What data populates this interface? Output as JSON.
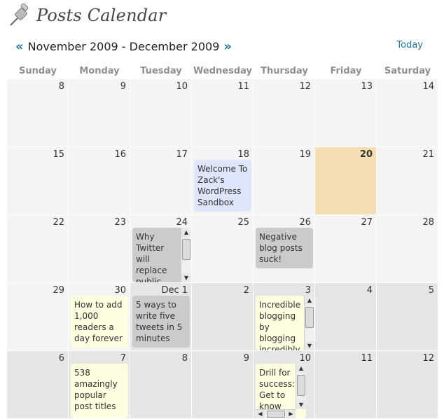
{
  "header": {
    "title": "Posts Calendar",
    "icon": "pushpin-icon"
  },
  "nav": {
    "prev": "«",
    "next": "»",
    "range": "November 2009 - December 2009",
    "today": "Today"
  },
  "weekdays": [
    "Sunday",
    "Monday",
    "Tuesday",
    "Wednesday",
    "Thursday",
    "Friday",
    "Saturday"
  ],
  "weeks": [
    {
      "days": [
        {
          "n": "8"
        },
        {
          "n": "9"
        },
        {
          "n": "10"
        },
        {
          "n": "11"
        },
        {
          "n": "12"
        },
        {
          "n": "13"
        },
        {
          "n": "14"
        }
      ]
    },
    {
      "days": [
        {
          "n": "15"
        },
        {
          "n": "16"
        },
        {
          "n": "17"
        },
        {
          "n": "18",
          "post": {
            "text": "Welcome To Zack's WordPress Sandbox",
            "color": "blue"
          }
        },
        {
          "n": "19"
        },
        {
          "n": "20",
          "today": true
        },
        {
          "n": "21"
        }
      ]
    },
    {
      "days": [
        {
          "n": "22"
        },
        {
          "n": "23"
        },
        {
          "n": "24",
          "post": {
            "text": "Why Twitter will replace public",
            "color": "gray",
            "scroll": "v"
          }
        },
        {
          "n": "25"
        },
        {
          "n": "26",
          "post": {
            "text": "Negative blog posts suck!",
            "color": "gray"
          }
        },
        {
          "n": "27"
        },
        {
          "n": "28"
        }
      ]
    },
    {
      "days": [
        {
          "n": "29"
        },
        {
          "n": "30",
          "post": {
            "text": "How to add 1,000 readers a day forever",
            "color": "yellow"
          }
        },
        {
          "n": "Dec 1",
          "dec": true,
          "post": {
            "text": "5 ways to write five tweets in 5 minutes",
            "color": "gray"
          }
        },
        {
          "n": "2",
          "dec": true
        },
        {
          "n": "3",
          "dec": true,
          "post": {
            "text": "Incredible blogging by blogging incredibly",
            "color": "yellow",
            "scroll": "v"
          }
        },
        {
          "n": "4",
          "dec": true
        },
        {
          "n": "5",
          "dec": true
        }
      ]
    },
    {
      "days": [
        {
          "n": "6",
          "dec": true
        },
        {
          "n": "7",
          "dec": true,
          "post": {
            "text": "538 amazingly popular post titles",
            "color": "yellow"
          }
        },
        {
          "n": "8",
          "dec": true
        },
        {
          "n": "9",
          "dec": true
        },
        {
          "n": "10",
          "dec": true,
          "post": {
            "text": "Drill for success: Get to know",
            "color": "yellow",
            "scroll": "vh"
          }
        },
        {
          "n": "11",
          "dec": true
        },
        {
          "n": "12",
          "dec": true
        }
      ]
    }
  ]
}
